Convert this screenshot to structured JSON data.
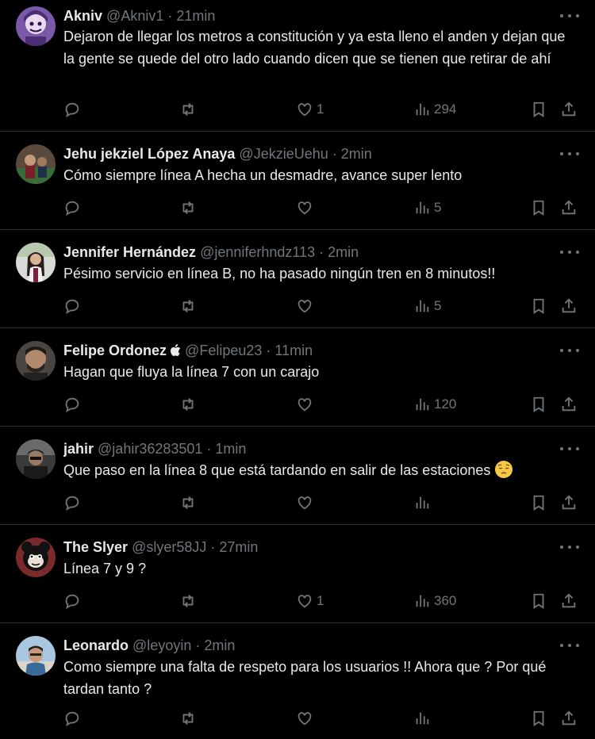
{
  "tweets": [
    {
      "name": "Akniv",
      "handle": "@Akniv1",
      "sep": " · ",
      "time": "21min",
      "text": "Dejaron de llegar los metros a constitución y ya esta lleno el anden y dejan que la gente se quede del otro lado cuando dicen que se tienen que retirar de ahí",
      "likes": "1",
      "views": "294"
    },
    {
      "name": "Jehu jekziel López Anaya",
      "handle": "@JekzieUehu",
      "sep": " · ",
      "time": "2min",
      "text": "Cómo siempre línea A hecha un desmadre, avance super lento",
      "likes": "",
      "views": "5"
    },
    {
      "name": "Jennifer Hernández",
      "handle": "@jenniferhndz113",
      "sep": " · ",
      "time": "2min",
      "text": "Pésimo servicio en línea B, no ha pasado ningún tren en 8 minutos!!",
      "likes": "",
      "views": "5"
    },
    {
      "name": "Felipe Ordonez",
      "handle": "@Felipeu23",
      "sep": " · ",
      "time": "11min",
      "text": "Hagan que fluya la línea 7 con un carajo",
      "likes": "",
      "views": "120"
    },
    {
      "name": "jahir",
      "handle": "@jahir36283501",
      "sep": " · ",
      "time": "1min",
      "text": "Que paso en la línea 8 que está tardando en salir de las estaciones",
      "likes": "",
      "views": ""
    },
    {
      "name": "The Slyer",
      "handle": "@slyer58JJ",
      "sep": " · ",
      "time": "27min",
      "text": "Línea 7 y 9 ?",
      "likes": "1",
      "views": "360"
    },
    {
      "name": "Leonardo",
      "handle": "@leyoyin",
      "sep": " · ",
      "time": "2min",
      "text": "Como siempre una falta de respeto para los usuarios !! Ahora que ? Por qué tardan tanto ?",
      "likes": "",
      "views": ""
    }
  ],
  "icons": {
    "reply": "reply-icon",
    "retweet": "retweet-icon",
    "like": "heart-icon",
    "views": "views-icon",
    "bookmark": "bookmark-icon",
    "share": "share-icon",
    "more": "more-icon",
    "verified_apple": "apple-icon",
    "emoji_pensive": "pensive-face-emoji"
  },
  "colors": {
    "background": "#000000",
    "text": "#e7e9ea",
    "muted": "#71767b",
    "divider": "#2f3336"
  }
}
